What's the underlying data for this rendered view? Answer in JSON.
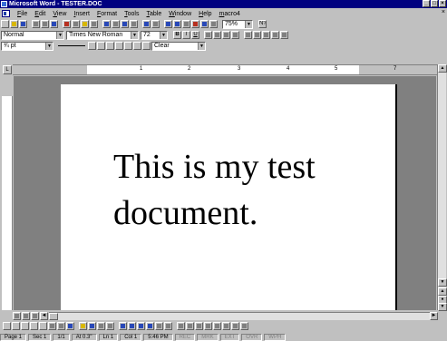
{
  "window": {
    "title": "Microsoft Word - TESTER.DOC",
    "minimize": "_",
    "maximize": "□",
    "close": "×"
  },
  "menu": {
    "items": [
      "File",
      "Edit",
      "View",
      "Insert",
      "Format",
      "Tools",
      "Table",
      "Window",
      "Help",
      "macro4"
    ],
    "doc_close": "×"
  },
  "standard_toolbar": {
    "zoom": "75%",
    "help_label": "N?"
  },
  "formatting_toolbar": {
    "style": "Normal",
    "font": "Times New Roman",
    "size": "72",
    "bold": "B",
    "italic": "I",
    "underline": "U"
  },
  "borders_toolbar": {
    "line_weight": "¾ pt",
    "shading": "Clear"
  },
  "ruler": {
    "tab_selector": "L",
    "numbers": [
      "1",
      "2",
      "3",
      "4",
      "5",
      "7"
    ]
  },
  "document": {
    "line1": "This is my test",
    "line2": "document."
  },
  "status": {
    "page": "Page 1",
    "section": "Sec 1",
    "page_of": "1/1",
    "at": "At 0.3\"",
    "line": "Ln 1",
    "col": "Col 1",
    "time": "5:46 PM",
    "rec": "REC",
    "mrk": "MRK",
    "ext": "EXT",
    "ovr": "OVR",
    "wph": "WPH"
  },
  "colors": {
    "title_bar": "#000080",
    "chrome": "#c0c0c0",
    "workspace": "#808080",
    "page": "#ffffff"
  }
}
